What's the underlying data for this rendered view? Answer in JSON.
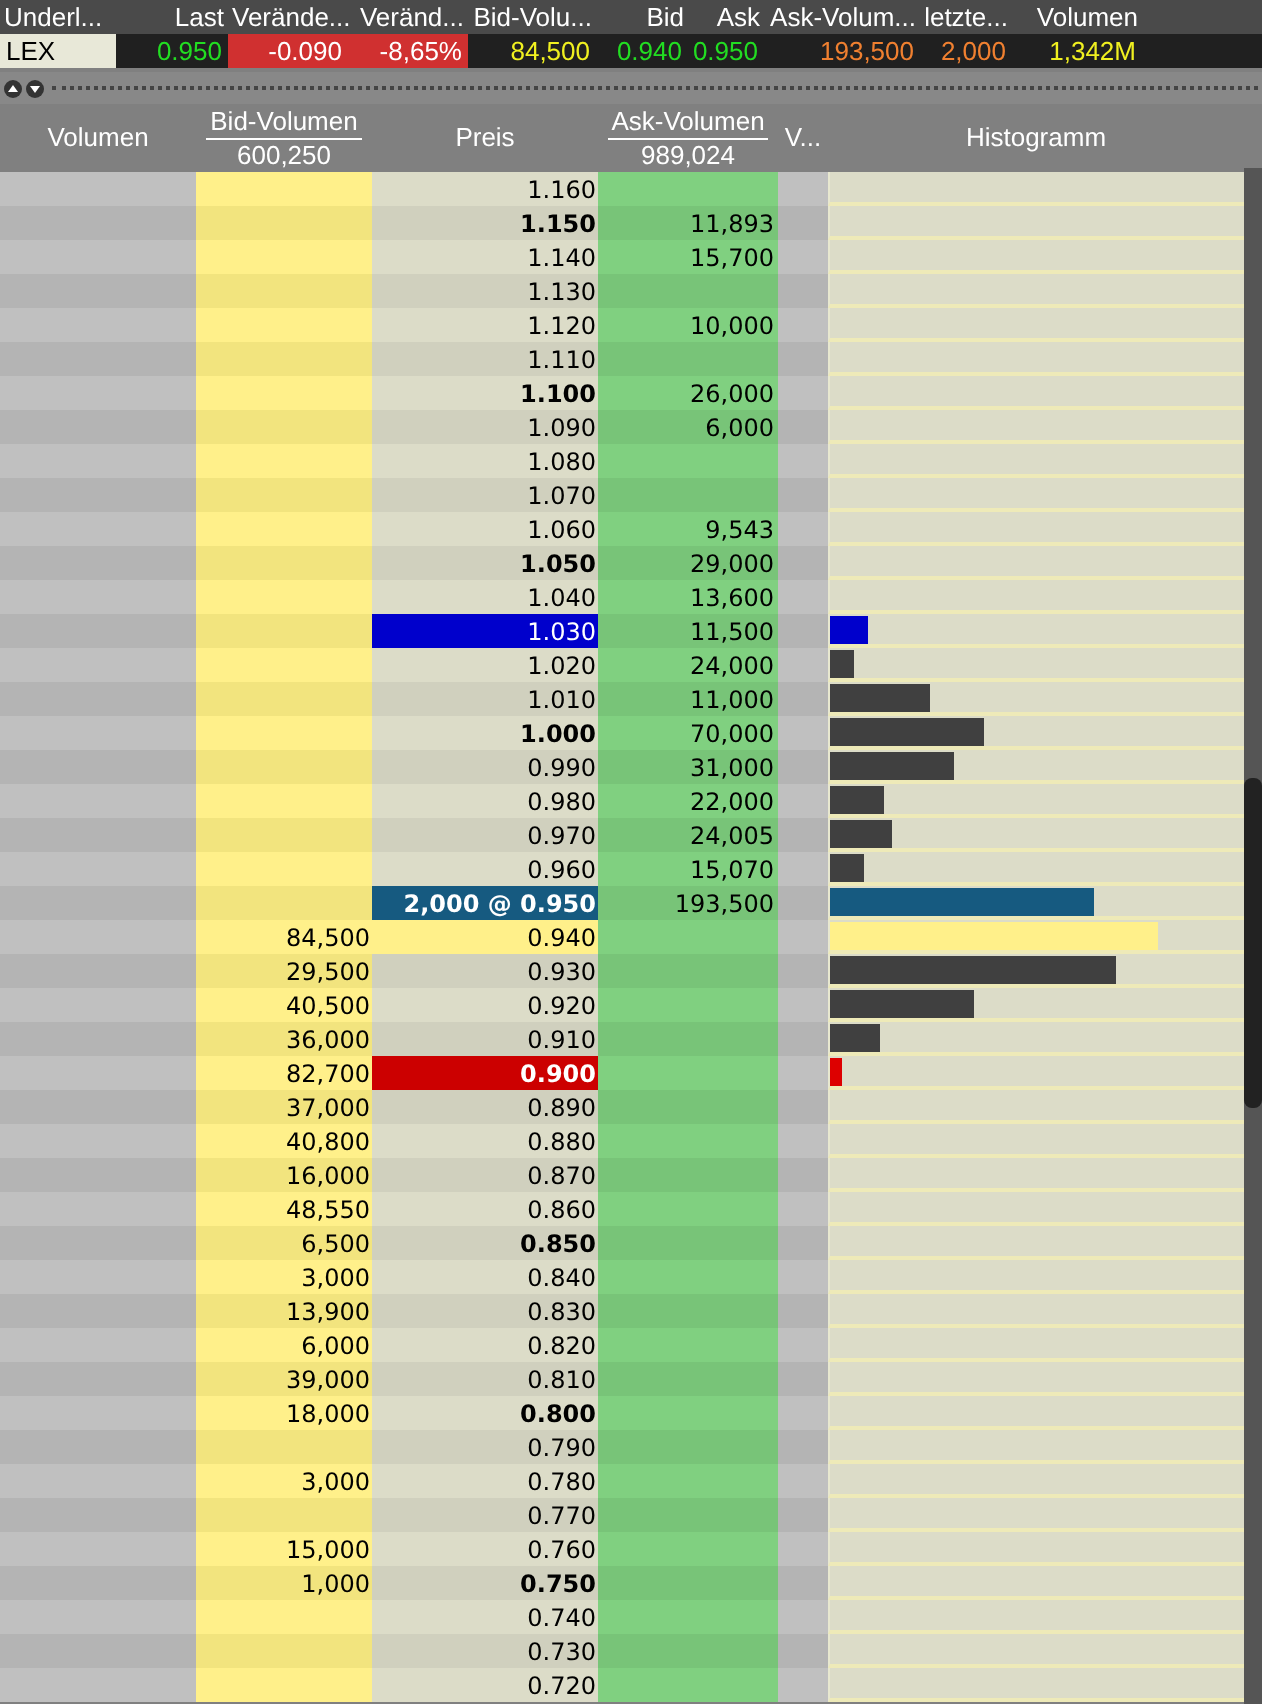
{
  "ticker": {
    "columns": [
      {
        "header": "Underl...",
        "value": "LEX",
        "kind": "symbol"
      },
      {
        "header": "Last",
        "value": "0.950",
        "kind": "price"
      },
      {
        "header": "Verände...",
        "value": "-0.090",
        "kind": "negative"
      },
      {
        "header": "Veränd...",
        "value": "-8,65%",
        "kind": "negative"
      },
      {
        "header": "Bid-Volu...",
        "value": "84,500",
        "kind": "volume"
      },
      {
        "header": "Bid",
        "value": "0.940",
        "kind": "price"
      },
      {
        "header": "Ask",
        "value": "0.950",
        "kind": "price"
      },
      {
        "header": "Ask-Volum...",
        "value": "193,500",
        "kind": "trade"
      },
      {
        "header": "letzte...",
        "value": "2,000",
        "kind": "trade"
      },
      {
        "header": "Volumen",
        "value": "1,342M",
        "kind": "volume"
      }
    ]
  },
  "book": {
    "columns": [
      {
        "label": "Volumen"
      },
      {
        "label": "Bid-Volumen",
        "total": "600,250"
      },
      {
        "label": "Preis"
      },
      {
        "label": "Ask-Volumen",
        "total": "989,024"
      },
      {
        "label": "V..."
      },
      {
        "label": "Histogramm"
      }
    ],
    "rows": [
      {
        "price": "1.160",
        "bold": false,
        "kind": "plain"
      },
      {
        "price": "1.150",
        "bold": true,
        "kind": "plain",
        "ask": "11,893"
      },
      {
        "price": "1.140",
        "bold": false,
        "kind": "plain",
        "ask": "15,700"
      },
      {
        "price": "1.130",
        "bold": false,
        "kind": "plain"
      },
      {
        "price": "1.120",
        "bold": false,
        "kind": "plain",
        "ask": "10,000"
      },
      {
        "price": "1.110",
        "bold": false,
        "kind": "plain"
      },
      {
        "price": "1.100",
        "bold": true,
        "kind": "plain",
        "ask": "26,000"
      },
      {
        "price": "1.090",
        "bold": false,
        "kind": "plain",
        "ask": "6,000"
      },
      {
        "price": "1.080",
        "bold": false,
        "kind": "plain"
      },
      {
        "price": "1.070",
        "bold": false,
        "kind": "plain"
      },
      {
        "price": "1.060",
        "bold": false,
        "kind": "plain",
        "ask": "9,543"
      },
      {
        "price": "1.050",
        "bold": true,
        "kind": "plain",
        "ask": "29,000"
      },
      {
        "price": "1.040",
        "bold": false,
        "kind": "plain",
        "ask": "13,600"
      },
      {
        "price": "1.030",
        "bold": false,
        "kind": "high",
        "ask": "11,500",
        "level": 0.09,
        "color": "#0000cc"
      },
      {
        "price": "1.020",
        "bold": false,
        "kind": "plain",
        "ask": "24,000",
        "level": 0.06,
        "color": "#404040"
      },
      {
        "price": "1.010",
        "bold": false,
        "kind": "plain",
        "ask": "11,000",
        "level": 0.24,
        "color": "#404040"
      },
      {
        "price": "1.000",
        "bold": true,
        "kind": "plain",
        "ask": "70,000",
        "level": 0.37,
        "color": "#404040"
      },
      {
        "price": "0.990",
        "bold": false,
        "kind": "plain",
        "ask": "31,000",
        "level": 0.3,
        "color": "#404040"
      },
      {
        "price": "0.980",
        "bold": false,
        "kind": "plain",
        "ask": "22,000",
        "level": 0.13,
        "color": "#404040"
      },
      {
        "price": "0.970",
        "bold": false,
        "kind": "plain",
        "ask": "24,005",
        "level": 0.15,
        "color": "#404040"
      },
      {
        "price": "0.960",
        "bold": false,
        "kind": "plain",
        "ask": "15,070",
        "level": 0.08,
        "color": "#404040"
      },
      {
        "price": "2,000 @ 0.950",
        "bold": true,
        "kind": "last",
        "ask": "193,500",
        "level": 0.64,
        "color": "#165a80"
      },
      {
        "price": "0.940",
        "bold": false,
        "kind": "bid",
        "bid": "84,500",
        "level": 0.79,
        "color": "#fff08a"
      },
      {
        "price": "0.930",
        "bold": false,
        "kind": "plain",
        "bid": "29,500",
        "level": 0.69,
        "color": "#404040"
      },
      {
        "price": "0.920",
        "bold": false,
        "kind": "plain",
        "bid": "40,500",
        "level": 0.35,
        "color": "#404040"
      },
      {
        "price": "0.910",
        "bold": false,
        "kind": "plain",
        "bid": "36,000",
        "level": 0.12,
        "color": "#404040"
      },
      {
        "price": "0.900",
        "bold": true,
        "kind": "low",
        "bid": "82,700",
        "level": 0.03,
        "color": "#dd0000"
      },
      {
        "price": "0.890",
        "bold": false,
        "kind": "plain",
        "bid": "37,000"
      },
      {
        "price": "0.880",
        "bold": false,
        "kind": "plain",
        "bid": "40,800"
      },
      {
        "price": "0.870",
        "bold": false,
        "kind": "plain",
        "bid": "16,000"
      },
      {
        "price": "0.860",
        "bold": false,
        "kind": "plain",
        "bid": "48,550"
      },
      {
        "price": "0.850",
        "bold": true,
        "kind": "plain",
        "bid": "6,500"
      },
      {
        "price": "0.840",
        "bold": false,
        "kind": "plain",
        "bid": "3,000"
      },
      {
        "price": "0.830",
        "bold": false,
        "kind": "plain",
        "bid": "13,900"
      },
      {
        "price": "0.820",
        "bold": false,
        "kind": "plain",
        "bid": "6,000"
      },
      {
        "price": "0.810",
        "bold": false,
        "kind": "plain",
        "bid": "39,000"
      },
      {
        "price": "0.800",
        "bold": true,
        "kind": "plain",
        "bid": "18,000"
      },
      {
        "price": "0.790",
        "bold": false,
        "kind": "plain"
      },
      {
        "price": "0.780",
        "bold": false,
        "kind": "plain",
        "bid": "3,000"
      },
      {
        "price": "0.770",
        "bold": false,
        "kind": "plain"
      },
      {
        "price": "0.760",
        "bold": false,
        "kind": "plain",
        "bid": "15,000"
      },
      {
        "price": "0.750",
        "bold": true,
        "kind": "plain",
        "bid": "1,000"
      },
      {
        "price": "0.740",
        "bold": false,
        "kind": "plain"
      },
      {
        "price": "0.730",
        "bold": false,
        "kind": "plain"
      },
      {
        "price": "0.720",
        "bold": false,
        "kind": "plain"
      }
    ]
  }
}
